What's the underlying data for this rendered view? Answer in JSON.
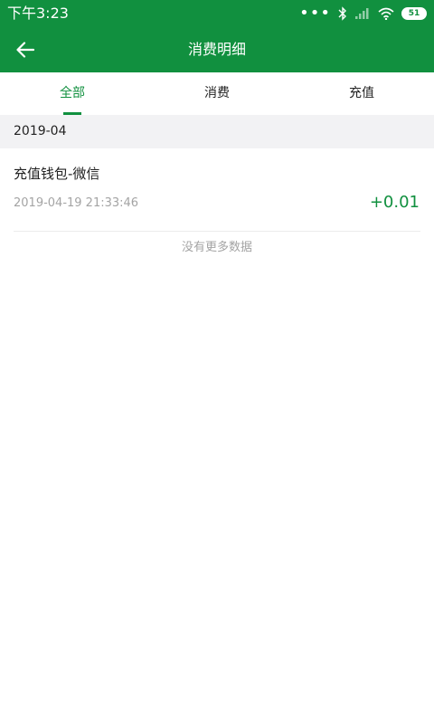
{
  "status_bar": {
    "time": "下午3:23",
    "dots": "•••",
    "battery": "51"
  },
  "header": {
    "title": "消费明细"
  },
  "tabs": [
    {
      "label": "全部",
      "active": true
    },
    {
      "label": "消费",
      "active": false
    },
    {
      "label": "充值",
      "active": false
    }
  ],
  "month": "2019-04",
  "records": [
    {
      "title": "充值钱包-微信",
      "time": "2019-04-19 21:33:46",
      "amount": "+0.01"
    }
  ],
  "footer_text": "没有更多数据",
  "colors": {
    "brand": "#11903f",
    "section_bg": "#f2f2f4",
    "muted_text": "#a4a4a4"
  }
}
